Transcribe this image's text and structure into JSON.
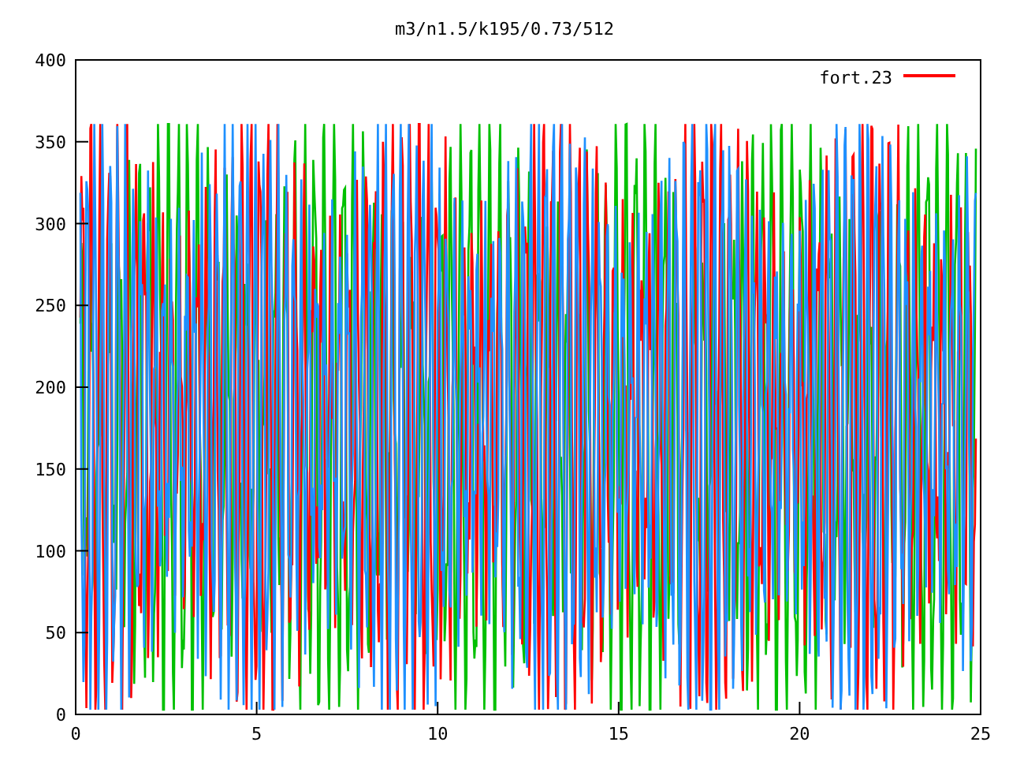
{
  "title": "m3/n1.5/k195/0.73/512",
  "y_axis": {
    "ticks": [
      "400",
      "350",
      "300",
      "250",
      "200",
      "150",
      "100",
      "50",
      "0"
    ]
  },
  "x_axis": {
    "ticks": [
      "0",
      "5",
      "10",
      "15",
      "20",
      "25"
    ]
  },
  "legend": [
    {
      "label": "fort.23",
      "color": "#ff0000"
    }
  ]
}
